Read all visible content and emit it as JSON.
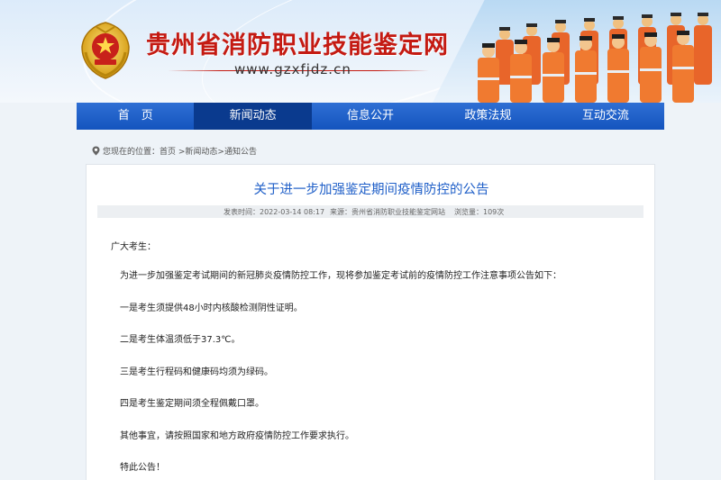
{
  "header": {
    "site_title": "贵州省消防职业技能鉴定网",
    "site_url": "www.gzxfjdz.cn"
  },
  "nav": {
    "items": [
      {
        "label": "首　页",
        "active": false
      },
      {
        "label": "新闻动态",
        "active": true
      },
      {
        "label": "信息公开",
        "active": false
      },
      {
        "label": "政策法规",
        "active": false
      },
      {
        "label": "互动交流",
        "active": false
      }
    ]
  },
  "breadcrumb": {
    "text": "您现在的位置：首页 >新闻动态>通知公告"
  },
  "article": {
    "title": "关于进一步加强鉴定期间疫情防控的公告",
    "publish_time": "发表时间：2022-03-14 08:17",
    "source": "来源：贵州省消防职业技能鉴定网站",
    "views": "浏览量：109次",
    "paragraphs": [
      "广大考生：",
      "为进一步加强鉴定考试期间的新冠肺炎疫情防控工作，现将参加鉴定考试前的疫情防控工作注意事项公告如下：",
      "一是考生须提供48小时内核酸检测阴性证明。",
      "二是考生体温须低于37.3℃。",
      "三是考生行程码和健康码均须为绿码。",
      "四是考生鉴定期间须全程佩戴口罩。",
      "其他事宜，请按照国家和地方政府疫情防控工作要求执行。",
      "特此公告！"
    ]
  },
  "colors": {
    "title_red": "#c41a12",
    "nav_blue": "#1454be",
    "nav_active": "#0a3a8e",
    "article_title_blue": "#1f5fc8"
  }
}
